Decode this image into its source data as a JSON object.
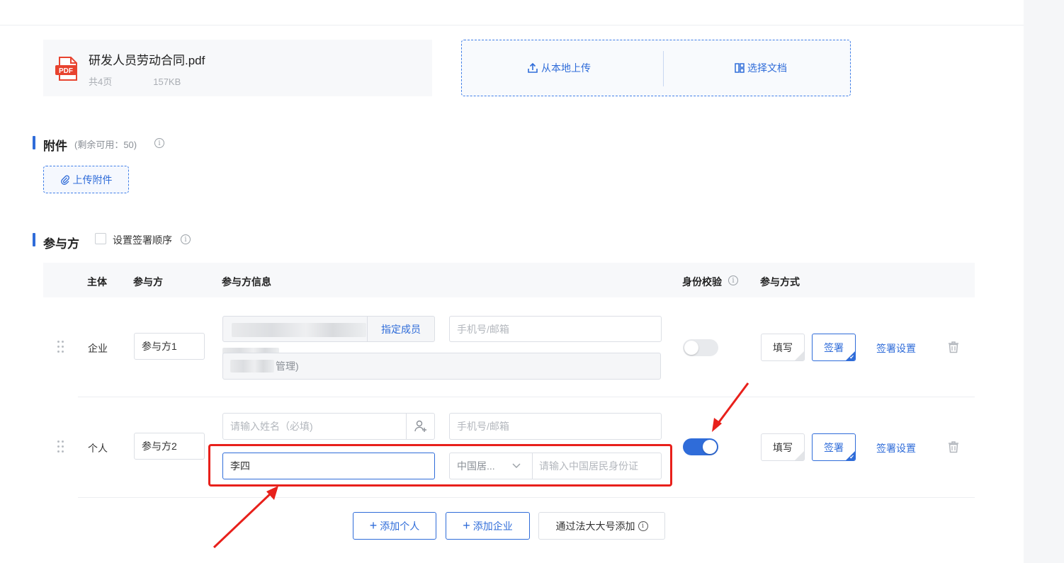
{
  "file": {
    "icon_label": "PDF",
    "name": "研发人员劳动合同.pdf",
    "pages": "共4页",
    "size": "157KB"
  },
  "upload": {
    "local": "从本地上传",
    "choose": "选择文档"
  },
  "attachments": {
    "title": "附件",
    "remaining": "(剩余可用：50)",
    "upload_button": "上传附件"
  },
  "participants": {
    "title": "参与方",
    "order_checkbox": "设置签署顺序",
    "headers": {
      "subject": "主体",
      "party": "参与方",
      "info": "参与方信息",
      "verify": "身份校验",
      "mode": "参与方式"
    },
    "rows": [
      {
        "subject": "企业",
        "party": "参与方1",
        "member_button": "指定成员",
        "phone_placeholder": "手机号/邮箱",
        "admin_suffix": "管理)",
        "verify_on": false,
        "fill": "填写",
        "sign": "签署",
        "settings": "签署设置"
      },
      {
        "subject": "个人",
        "party": "参与方2",
        "name_placeholder": "请输入姓名（必填)",
        "phone_placeholder": "手机号/邮箱",
        "name_value": "李四",
        "id_type": "中国居...",
        "id_placeholder": "请输入中国居民身份证",
        "verify_on": true,
        "fill": "填写",
        "sign": "签署",
        "settings": "签署设置"
      }
    ],
    "add_person": "添加个人",
    "add_company": "添加企业",
    "add_via_account": "通过法大大号添加"
  },
  "colors": {
    "accent": "#2f6cd9",
    "annotation": "#e8201b"
  }
}
